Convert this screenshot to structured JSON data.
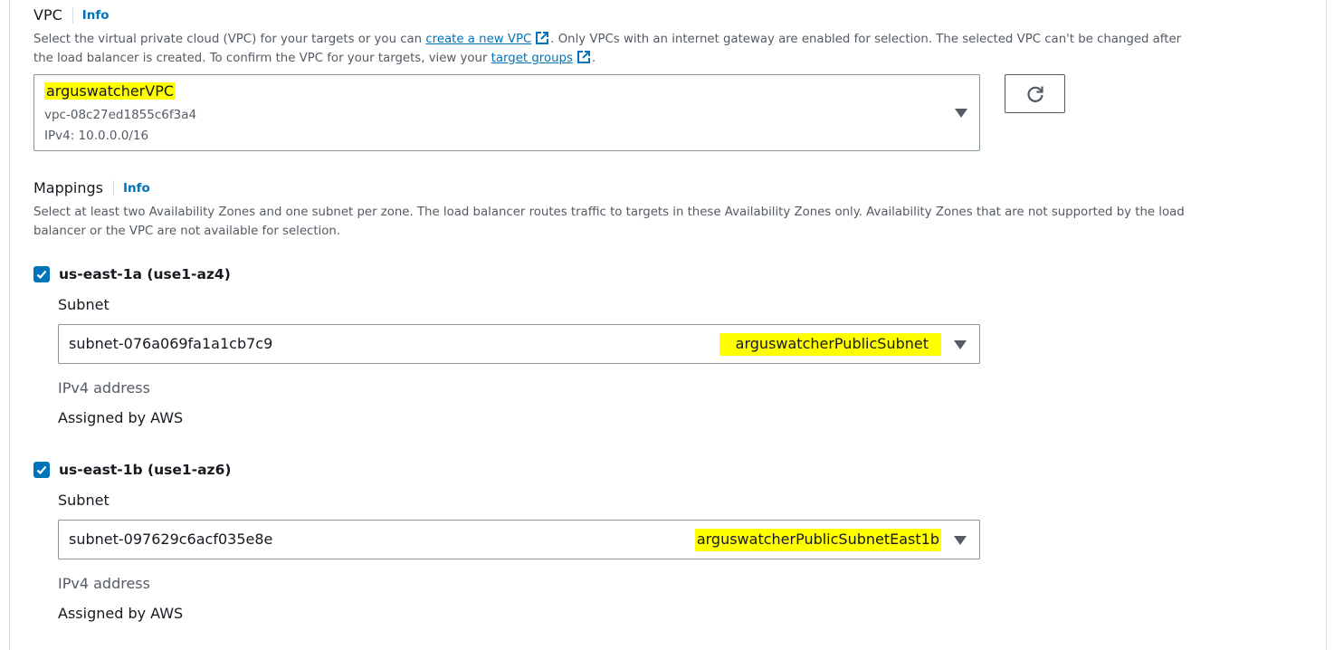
{
  "vpc": {
    "label": "VPC",
    "info": "Info",
    "desc_part1": "Select the virtual private cloud (VPC) for your targets or you can ",
    "create_link": "create a new VPC",
    "desc_part2": ". Only VPCs with an internet gateway are enabled for selection. The selected VPC can't be changed after",
    "desc_part3": "the load balancer is created. To confirm the VPC for your targets, view your ",
    "target_groups_link": "target groups",
    "desc_part4": ".",
    "selected_name": "arguswatcherVPC",
    "selected_id": "vpc-08c27ed1855c6f3a4",
    "selected_cidr": "IPv4: 10.0.0.0/16"
  },
  "mappings": {
    "label": "Mappings",
    "info": "Info",
    "desc_line1": "Select at least two Availability Zones and one subnet per zone. The load balancer routes traffic to targets in these Availability Zones only. Availability Zones that are not supported by the load",
    "desc_line2": "balancer or the VPC are not available for selection.",
    "zones": [
      {
        "label": "us-east-1a (use1-az4)",
        "checked": true,
        "subnet_label": "Subnet",
        "subnet_id": "subnet-076a069fa1a1cb7c9",
        "subnet_name": "arguswatcherPublicSubnet",
        "ip_label": "IPv4 address",
        "ip_value": "Assigned by AWS"
      },
      {
        "label": "us-east-1b (use1-az6)",
        "checked": true,
        "subnet_label": "Subnet",
        "subnet_id": "subnet-097629c6acf035e8e",
        "subnet_name": "arguswatcherPublicSubnetEast1b",
        "ip_label": "IPv4 address",
        "ip_value": "Assigned by AWS"
      }
    ]
  },
  "colors": {
    "highlight": "#ffff00",
    "link": "#0073bb",
    "checkbox": "#0073bb"
  },
  "icons": {
    "external_link": "external-link-icon",
    "refresh": "refresh-icon",
    "caret": "caret-down-icon",
    "check": "check-icon"
  }
}
